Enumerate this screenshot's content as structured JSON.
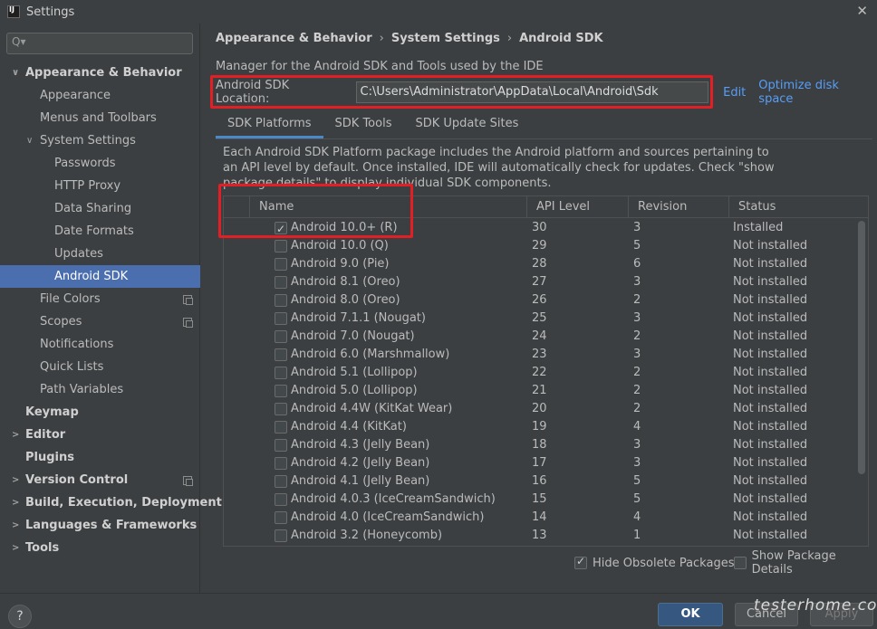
{
  "window": {
    "title": "Settings",
    "close_glyph": "✕"
  },
  "sidebar": {
    "search_glyph": "Q▾",
    "items": [
      {
        "label": "Appearance & Behavior",
        "level": 0,
        "arrow": "∨",
        "bold": true
      },
      {
        "label": "Appearance",
        "level": 1
      },
      {
        "label": "Menus and Toolbars",
        "level": 1
      },
      {
        "label": "System Settings",
        "level": 1,
        "arrow": "∨"
      },
      {
        "label": "Passwords",
        "level": 2
      },
      {
        "label": "HTTP Proxy",
        "level": 2
      },
      {
        "label": "Data Sharing",
        "level": 2
      },
      {
        "label": "Date Formats",
        "level": 2
      },
      {
        "label": "Updates",
        "level": 2
      },
      {
        "label": "Android SDK",
        "level": 2,
        "selected": true
      },
      {
        "label": "File Colors",
        "level": 1,
        "copy": true
      },
      {
        "label": "Scopes",
        "level": 1,
        "copy": true
      },
      {
        "label": "Notifications",
        "level": 1
      },
      {
        "label": "Quick Lists",
        "level": 1
      },
      {
        "label": "Path Variables",
        "level": 1
      },
      {
        "label": "Keymap",
        "level": 0,
        "bold": true
      },
      {
        "label": "Editor",
        "level": 0,
        "arrow": ">",
        "bold": true
      },
      {
        "label": "Plugins",
        "level": 0,
        "bold": true
      },
      {
        "label": "Version Control",
        "level": 0,
        "arrow": ">",
        "bold": true,
        "copy": true
      },
      {
        "label": "Build, Execution, Deployment",
        "level": 0,
        "arrow": ">",
        "bold": true
      },
      {
        "label": "Languages & Frameworks",
        "level": 0,
        "arrow": ">",
        "bold": true
      },
      {
        "label": "Tools",
        "level": 0,
        "arrow": ">",
        "bold": true
      }
    ]
  },
  "main": {
    "breadcrumb": [
      "Appearance & Behavior",
      "System Settings",
      "Android SDK"
    ],
    "breadcrumb_sep": "›",
    "description": "Manager for the Android SDK and Tools used by the IDE",
    "sdk_location_label": "Android SDK Location:",
    "sdk_location_value": "C:\\Users\\Administrator\\AppData\\Local\\Android\\Sdk",
    "edit_link": "Edit",
    "optimize_link": "Optimize disk space",
    "tabs": [
      "SDK Platforms",
      "SDK Tools",
      "SDK Update Sites"
    ],
    "active_tab": 0,
    "platform_description": "Each Android SDK Platform package includes the Android platform and sources pertaining to an API level by default. Once installed, IDE will automatically check for updates. Check \"show package details\" to display individual SDK components.",
    "table": {
      "columns": [
        "Name",
        "API Level",
        "Revision",
        "Status"
      ],
      "rows": [
        {
          "name": "Android 10.0+ (R)",
          "api": "30",
          "rev": "3",
          "status": "Installed",
          "checked": true
        },
        {
          "name": "Android 10.0 (Q)",
          "api": "29",
          "rev": "5",
          "status": "Not installed",
          "checked": false
        },
        {
          "name": "Android 9.0 (Pie)",
          "api": "28",
          "rev": "6",
          "status": "Not installed",
          "checked": false
        },
        {
          "name": "Android 8.1 (Oreo)",
          "api": "27",
          "rev": "3",
          "status": "Not installed",
          "checked": false
        },
        {
          "name": "Android 8.0 (Oreo)",
          "api": "26",
          "rev": "2",
          "status": "Not installed",
          "checked": false
        },
        {
          "name": "Android 7.1.1 (Nougat)",
          "api": "25",
          "rev": "3",
          "status": "Not installed",
          "checked": false
        },
        {
          "name": "Android 7.0 (Nougat)",
          "api": "24",
          "rev": "2",
          "status": "Not installed",
          "checked": false
        },
        {
          "name": "Android 6.0 (Marshmallow)",
          "api": "23",
          "rev": "3",
          "status": "Not installed",
          "checked": false
        },
        {
          "name": "Android 5.1 (Lollipop)",
          "api": "22",
          "rev": "2",
          "status": "Not installed",
          "checked": false
        },
        {
          "name": "Android 5.0 (Lollipop)",
          "api": "21",
          "rev": "2",
          "status": "Not installed",
          "checked": false
        },
        {
          "name": "Android 4.4W (KitKat Wear)",
          "api": "20",
          "rev": "2",
          "status": "Not installed",
          "checked": false
        },
        {
          "name": "Android 4.4 (KitKat)",
          "api": "19",
          "rev": "4",
          "status": "Not installed",
          "checked": false
        },
        {
          "name": "Android 4.3 (Jelly Bean)",
          "api": "18",
          "rev": "3",
          "status": "Not installed",
          "checked": false
        },
        {
          "name": "Android 4.2 (Jelly Bean)",
          "api": "17",
          "rev": "3",
          "status": "Not installed",
          "checked": false
        },
        {
          "name": "Android 4.1 (Jelly Bean)",
          "api": "16",
          "rev": "5",
          "status": "Not installed",
          "checked": false
        },
        {
          "name": "Android 4.0.3 (IceCreamSandwich)",
          "api": "15",
          "rev": "5",
          "status": "Not installed",
          "checked": false
        },
        {
          "name": "Android 4.0 (IceCreamSandwich)",
          "api": "14",
          "rev": "4",
          "status": "Not installed",
          "checked": false
        },
        {
          "name": "Android 3.2 (Honeycomb)",
          "api": "13",
          "rev": "1",
          "status": "Not installed",
          "checked": false
        }
      ]
    },
    "hide_obsolete_label": "Hide Obsolete Packages",
    "hide_obsolete_checked": true,
    "show_details_label": "Show Package Details",
    "show_details_checked": false
  },
  "footer": {
    "help_label": "?",
    "ok_label": "OK",
    "cancel_label": "Cancel",
    "apply_label": "Apply",
    "watermark": "testerhome.com"
  },
  "colors": {
    "highlight_box": "#e31e24",
    "selection": "#4b6eaf",
    "link": "#589df6",
    "ok_button": "#365880"
  }
}
